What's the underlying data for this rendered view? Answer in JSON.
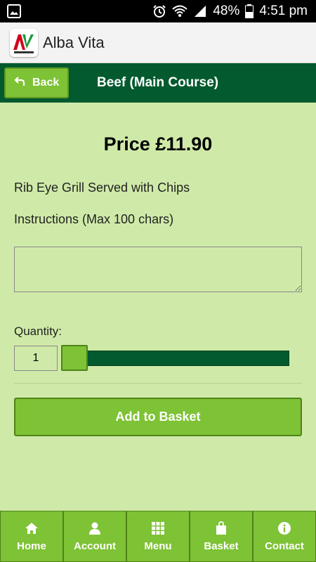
{
  "status_bar": {
    "battery": "48%",
    "time": "4:51 pm"
  },
  "app": {
    "title": "Alba Vita"
  },
  "header": {
    "back_label": "Back",
    "title": "Beef (Main Course)"
  },
  "product": {
    "price": "Price £11.90",
    "description": "Rib Eye Grill Served with Chips",
    "instructions_label": "Instructions (Max 100 chars)",
    "instructions_value": "",
    "quantity_label": "Quantity:",
    "quantity_value": "1",
    "quantity_slider_level": 0
  },
  "actions": {
    "add_to_basket": "Add to Basket"
  },
  "footer_nav": {
    "home": "Home",
    "account": "Account",
    "menu": "Menu",
    "basket": "Basket",
    "contact": "Contact"
  },
  "colors": {
    "page_background": "#cfeaa8",
    "header_green": "#035a2e",
    "button_green": "#7ec235"
  }
}
